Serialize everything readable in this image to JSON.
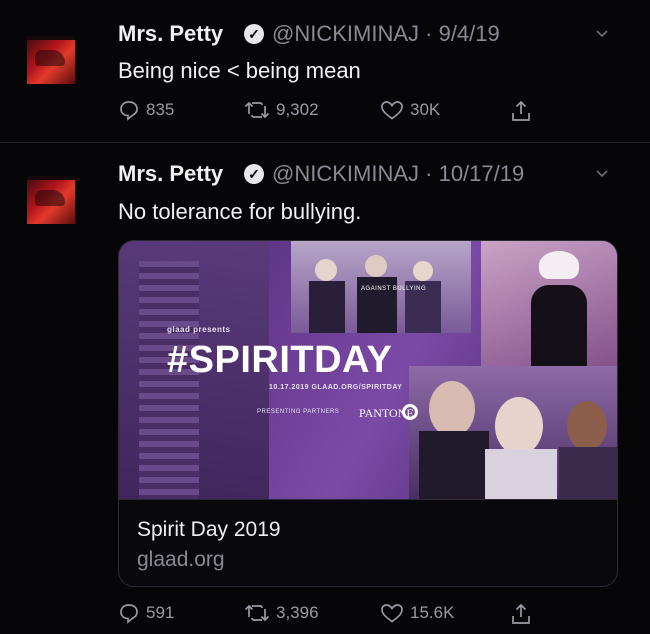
{
  "tweets": [
    {
      "name": "Mrs. Petty",
      "handle": "@NICKIMINAJ",
      "date": "9/4/19",
      "text": "Being nice < being mean",
      "replies": "835",
      "retweets": "9,302",
      "likes": "30K"
    },
    {
      "name": "Mrs. Petty",
      "handle": "@NICKIMINAJ",
      "date": "10/17/19",
      "text": "No tolerance for bullying.",
      "card": {
        "image_headline": "#SPIRITDAY",
        "image_presents": "glaad presents",
        "image_url_line": "10.17.2019 GLAAD.ORG/SPIRITDAY",
        "image_partners": "PRESENTING PARTNERS",
        "image_sponsor": "PANTONE",
        "image_sign": "AGAINST BULLYING",
        "title": "Spirit Day 2019",
        "domain": "glaad.org"
      },
      "replies": "591",
      "retweets": "3,396",
      "likes": "15.6K"
    }
  ],
  "icons": {
    "verified": "verified-badge-icon",
    "reply": "reply-icon",
    "retweet": "retweet-icon",
    "like": "heart-icon",
    "share": "share-icon",
    "more": "chevron-down-icon"
  },
  "colors": {
    "background": "#060507",
    "text": "#f1f1f3",
    "muted": "#8a8a94",
    "card_purple": "#6a3d93"
  }
}
